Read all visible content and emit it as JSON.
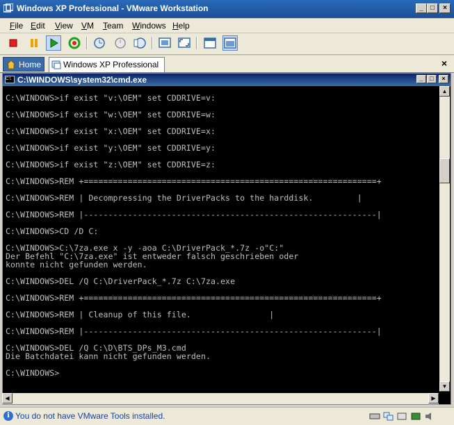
{
  "window": {
    "title": "Windows XP Professional - VMware Workstation"
  },
  "menu": [
    {
      "label": "File",
      "u": "F",
      "rest": "ile"
    },
    {
      "label": "Edit",
      "u": "E",
      "rest": "dit"
    },
    {
      "label": "View",
      "u": "V",
      "rest": "iew"
    },
    {
      "label": "VM",
      "u": "V",
      "rest": "M"
    },
    {
      "label": "Team",
      "u": "T",
      "rest": "eam"
    },
    {
      "label": "Windows",
      "u": "W",
      "rest": "indows"
    },
    {
      "label": "Help",
      "u": "H",
      "rest": "elp"
    }
  ],
  "tabs": {
    "home": "Home",
    "vm": "Windows XP Professional"
  },
  "cmd": {
    "title": "C:\\WINDOWS\\system32\\cmd.exe",
    "lines": [
      "C:\\WINDOWS>if exist \"v:\\OEM\" set CDDRIVE=v:",
      "",
      "C:\\WINDOWS>if exist \"w:\\OEM\" set CDDRIVE=w:",
      "",
      "C:\\WINDOWS>if exist \"x:\\OEM\" set CDDRIVE=x:",
      "",
      "C:\\WINDOWS>if exist \"y:\\OEM\" set CDDRIVE=y:",
      "",
      "C:\\WINDOWS>if exist \"z:\\OEM\" set CDDRIVE=z:",
      "",
      "C:\\WINDOWS>REM +============================================================+",
      "",
      "C:\\WINDOWS>REM | Decompressing the DriverPacks to the harddisk.         |",
      "",
      "C:\\WINDOWS>REM |------------------------------------------------------------|",
      "",
      "C:\\WINDOWS>CD /D C:",
      "",
      "C:\\WINDOWS>C:\\7za.exe x -y -aoa C:\\DriverPack_*.7z -o\"C:\"",
      "Der Befehl \"C:\\7za.exe\" ist entweder falsch geschrieben oder",
      "konnte nicht gefunden werden.",
      "",
      "C:\\WINDOWS>DEL /Q C:\\DriverPack_*.7z C:\\7za.exe",
      "",
      "C:\\WINDOWS>REM +============================================================+",
      "",
      "C:\\WINDOWS>REM | Cleanup of this file.                |",
      "",
      "C:\\WINDOWS>REM |------------------------------------------------------------|",
      "",
      "C:\\WINDOWS>DEL /Q C:\\D\\BTS_DPs_M3.cmd",
      "Die Batchdatei kann nicht gefunden werden.",
      "",
      "C:\\WINDOWS>"
    ]
  },
  "status": {
    "message": "You do not have VMware Tools installed."
  },
  "colors": {
    "console_bg": "#000000",
    "console_fg": "#c0c0c0",
    "titlebar": "#1b4f96",
    "status_text": "#1a3f9c"
  },
  "icons": {
    "toolbar": [
      "stop-icon",
      "pause-icon",
      "play-icon",
      "reset-icon",
      "snapshot-icon",
      "revert-snapshot-icon",
      "snapshot-manager-icon",
      "quick-switch-icon",
      "fullscreen-icon",
      "summary-view-icon",
      "console-view-icon"
    ],
    "status": [
      "hard-disk-icon",
      "network-icon",
      "usb-icon",
      "device-icon",
      "sound-icon"
    ]
  }
}
